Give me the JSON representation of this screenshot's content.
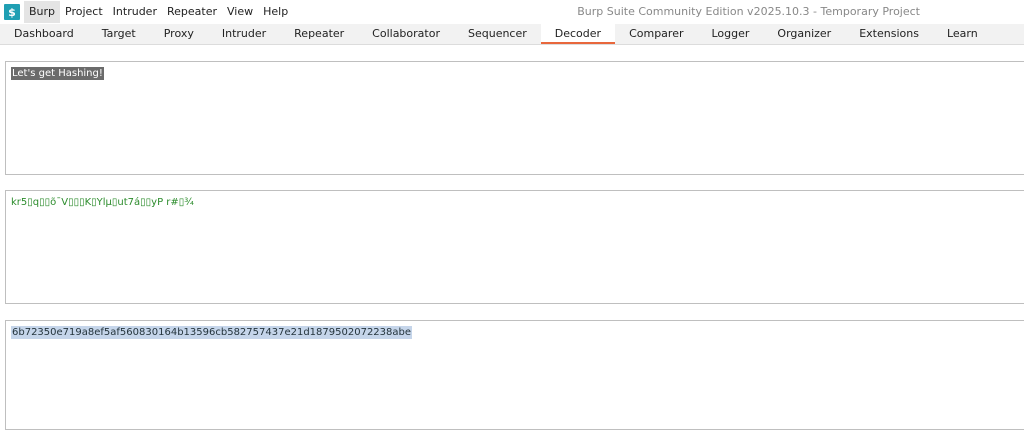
{
  "app": {
    "logo_glyph": "$",
    "title": "Burp Suite Community Edition v2025.10.3 - Temporary Project"
  },
  "menu": [
    "Burp",
    "Project",
    "Intruder",
    "Repeater",
    "View",
    "Help"
  ],
  "tabs": [
    "Dashboard",
    "Target",
    "Proxy",
    "Intruder",
    "Repeater",
    "Collaborator",
    "Sequencer",
    "Decoder",
    "Comparer",
    "Logger",
    "Organizer",
    "Extensions",
    "Learn"
  ],
  "active_tab": "Decoder",
  "decoder": {
    "input_text": "Let's get Hashing!",
    "raw_hash_text": "kr5▯q▯▯õ¯V▯▯▯K▯Ylµ▯ut7á▯▯yP r#▯¾",
    "hex_text": "6b72350e719a8ef5af560830164b13596cb582757437e21d1879502072238abe"
  },
  "colors": {
    "accent": "#e8673c",
    "logo": "#1f9fb3",
    "green_text": "#2c8c2c",
    "selection_light": "#c5d5ea",
    "selection_dark": "#6b6b6b"
  }
}
